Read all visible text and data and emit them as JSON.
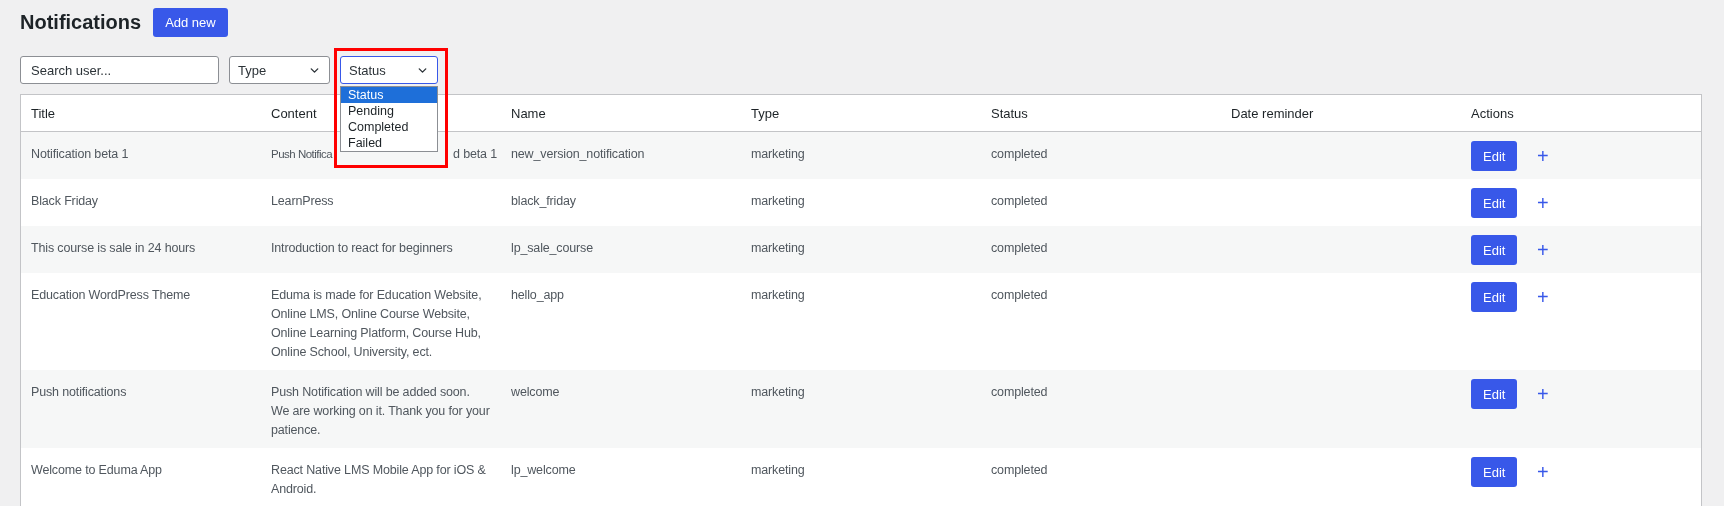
{
  "page": {
    "title": "Notifications",
    "add_button": "Add new"
  },
  "filters": {
    "search": {
      "placeholder": "Search user..."
    },
    "type_select": {
      "value": "Type"
    },
    "status_select": {
      "value": "Status",
      "expanded": true,
      "options": [
        {
          "label": "Status",
          "selected": true
        },
        {
          "label": "Pending",
          "selected": false
        },
        {
          "label": "Completed",
          "selected": false
        },
        {
          "label": "Failed",
          "selected": false
        }
      ]
    }
  },
  "table": {
    "columns": [
      "Title",
      "Content",
      "Name",
      "Type",
      "Status",
      "Date reminder",
      "Actions"
    ],
    "rows": [
      {
        "title": "Notification beta 1",
        "content_parts": [
          "Push Notifica",
          "d beta 1"
        ],
        "name": "new_version_notification",
        "type": "marketing",
        "status": "completed",
        "edit": "Edit",
        "add": "+"
      },
      {
        "title": "Black Friday",
        "content_parts": [
          "LearnPress"
        ],
        "name": "black_friday",
        "type": "marketing",
        "status": "completed",
        "edit": "Edit",
        "add": "+"
      },
      {
        "title": "This course is sale in 24 hours",
        "content_parts": [
          "Introduction to react for beginners"
        ],
        "name": "lp_sale_course",
        "type": "marketing",
        "status": "completed",
        "edit": "Edit",
        "add": "+"
      },
      {
        "title": "Education WordPress Theme",
        "content_parts": [
          "Eduma is made for Education Website, Online LMS, Online Course Website, Online Learning Platform, Course Hub, Online School, University, ect."
        ],
        "name": "hello_app",
        "type": "marketing",
        "status": "completed",
        "edit": "Edit",
        "add": "+"
      },
      {
        "title": "Push notifications",
        "content_parts": [
          "Push Notification will be added soon. We are working on it. Thank you for your patience."
        ],
        "name": "welcome",
        "type": "marketing",
        "status": "completed",
        "edit": "Edit",
        "add": "+"
      },
      {
        "title": "Welcome to Eduma App",
        "content_parts": [
          "React Native LMS Mobile App for iOS & Android."
        ],
        "name": "lp_welcome",
        "type": "marketing",
        "status": "completed",
        "edit": "Edit",
        "add": "+"
      }
    ]
  }
}
